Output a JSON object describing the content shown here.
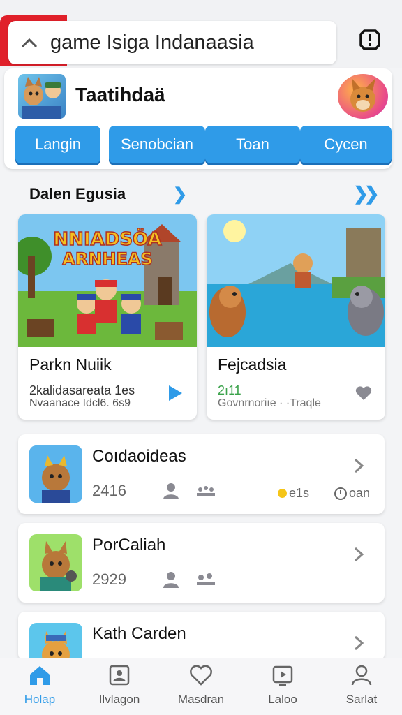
{
  "search": {
    "value": "game Isiga Indanaasia",
    "placeholder": ""
  },
  "profile": {
    "name": "Taatihdaä"
  },
  "tabs": [
    {
      "label": "Langin"
    },
    {
      "label": "Senobcian"
    },
    {
      "label": "Toan"
    },
    {
      "label": "Cycen"
    }
  ],
  "section": {
    "title": "Dalen Egusia"
  },
  "featured": [
    {
      "art_title_1": "NNIADSÖA",
      "art_title_2": "ARNHEAS",
      "title": "Parkn Nuiik",
      "line1": "2kalidasareata 1es",
      "line2": "Nvaanace Idcl6. 6s9"
    },
    {
      "title": "Fejcadsia",
      "line1": "2ı11",
      "line2": "Govnrnoriıe · ·Traqle"
    }
  ],
  "games": [
    {
      "name": "Coıdaoideas",
      "number": "2416",
      "extra": "e1s",
      "extra2": "oan"
    },
    {
      "name": "PorCaliah",
      "number": "2929"
    },
    {
      "name": "Kath Carden"
    }
  ],
  "nav": [
    {
      "label": "Holap"
    },
    {
      "label": "Ilvlagon"
    },
    {
      "label": "Masdran"
    },
    {
      "label": "Laloo"
    },
    {
      "label": "Sarlat"
    }
  ],
  "colors": {
    "accent": "#2f9be8",
    "brand_red": "#e0202a",
    "online_dot": "#f5c518",
    "green_text": "#3aa24a"
  }
}
